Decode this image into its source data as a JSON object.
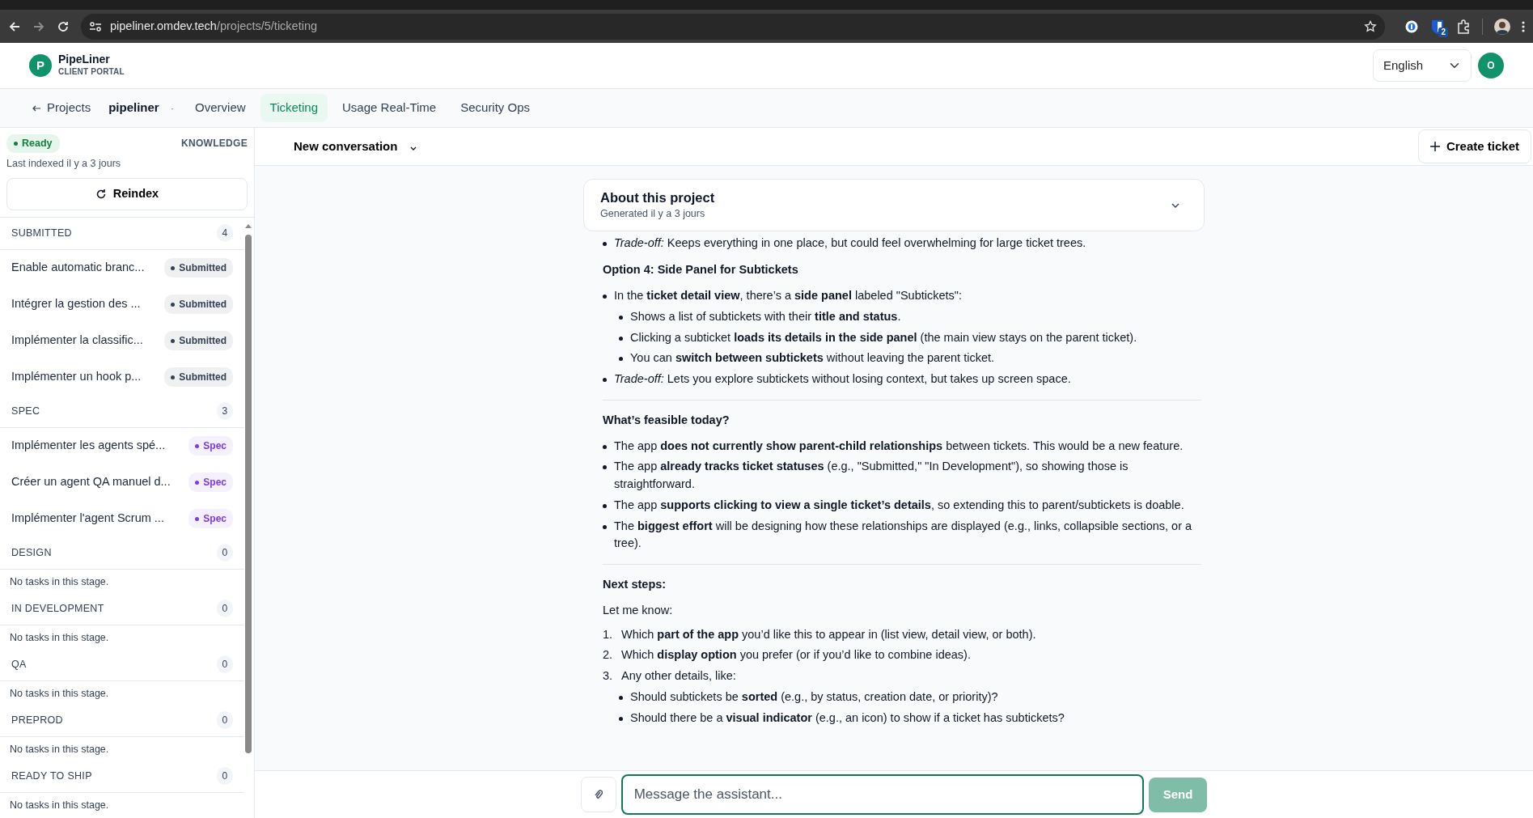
{
  "browser": {
    "url_host": "pipeliner.omdev.tech",
    "url_path": "/projects/5/ticketing",
    "extension_badge": "2"
  },
  "header": {
    "logo_letter": "P",
    "app_name": "PipeLiner",
    "app_subtitle": "CLIENT PORTAL",
    "language": "English",
    "avatar_letter": "O"
  },
  "nav": {
    "back": "Projects",
    "project": "pipeliner",
    "separator": "·",
    "tabs": [
      {
        "label": "Overview",
        "selected": false
      },
      {
        "label": "Ticketing",
        "selected": true
      },
      {
        "label": "Usage Real-Time",
        "selected": false
      },
      {
        "label": "Security Ops",
        "selected": false
      }
    ]
  },
  "sidebar": {
    "status": "Ready",
    "knowledge": "KNOWLEDGE",
    "last_indexed": "Last indexed il y a 3 jours",
    "reindex": "Reindex",
    "stages": [
      {
        "name": "SUBMITTED",
        "count": "4",
        "tickets": [
          {
            "title": "Enable automatic branc...",
            "status": "Submitted",
            "color": "#334155"
          },
          {
            "title": "Intégrer la gestion des ...",
            "status": "Submitted",
            "color": "#334155"
          },
          {
            "title": "Implémenter la classific...",
            "status": "Submitted",
            "color": "#334155"
          },
          {
            "title": "Implémenter un hook p...",
            "status": "Submitted",
            "color": "#334155"
          }
        ]
      },
      {
        "name": "SPEC",
        "count": "3",
        "tickets": [
          {
            "title": "Implémenter les agents spé...",
            "status": "Spec",
            "color": "#7c3aed"
          },
          {
            "title": "Créer un agent QA manuel d...",
            "status": "Spec",
            "color": "#7c3aed"
          },
          {
            "title": "Implémenter l'agent Scrum ...",
            "status": "Spec",
            "color": "#7c3aed"
          }
        ]
      },
      {
        "name": "DESIGN",
        "count": "0",
        "empty": "No tasks in this stage."
      },
      {
        "name": "IN DEVELOPMENT",
        "count": "0",
        "empty": "No tasks in this stage."
      },
      {
        "name": "QA",
        "count": "0",
        "empty": "No tasks in this stage."
      },
      {
        "name": "PREPROD",
        "count": "0",
        "empty": "No tasks in this stage."
      },
      {
        "name": "READY TO SHIP",
        "count": "0",
        "empty": "No tasks in this stage."
      }
    ]
  },
  "chat": {
    "conversation": "New conversation",
    "create_ticket": "Create ticket",
    "about": {
      "title": "About this project",
      "subtitle": "Generated il y a 3 jours",
      "expanded": false
    },
    "blocks": [
      {
        "kind": "bullets",
        "items": [
          {
            "text": "*Trade-off:* Keeps everything in one place, but could feel overwhelming for large ticket trees."
          }
        ]
      },
      {
        "kind": "heading",
        "text": "Option 4: Side Panel for Subtickets"
      },
      {
        "kind": "bullets",
        "items": [
          {
            "text": "In the **ticket detail view**, there’s a **side panel** labeled \"Subtickets\":",
            "children": [
              {
                "text": "Shows a list of subtickets with their **title and status**."
              },
              {
                "text": "Clicking a subticket **loads its details in the side panel** (the main view stays on the parent ticket)."
              },
              {
                "text": "You can **switch between subtickets** without leaving the parent ticket."
              }
            ]
          },
          {
            "text": "*Trade-off:* Lets you explore subtickets without losing context, but takes up screen space."
          }
        ]
      },
      {
        "kind": "divider"
      },
      {
        "kind": "heading",
        "text": "What’s feasible today?"
      },
      {
        "kind": "bullets",
        "items": [
          {
            "text": "The app **does not currently show parent-child relationships** between tickets. This would be a new feature."
          },
          {
            "text": "The app **already tracks ticket statuses** (e.g., \"Submitted,\" \"In Development\"), so showing those is straightforward."
          },
          {
            "text": "The app **supports clicking to view a single ticket’s details**, so extending this to parent/subtickets is doable."
          },
          {
            "text": "The **biggest effort** will be designing how these relationships are displayed (e.g., links, collapsible sections, or a tree)."
          }
        ]
      },
      {
        "kind": "divider"
      },
      {
        "kind": "heading",
        "text": "Next steps:"
      },
      {
        "kind": "paragraph",
        "text": "Let me know:"
      },
      {
        "kind": "numbered",
        "items": [
          {
            "number": "1.",
            "text": "Which **part of the app** you’d like this to appear in (list view, detail view, or both)."
          },
          {
            "number": "2.",
            "text": "Which **display option** you prefer (or if you’d like to combine ideas)."
          },
          {
            "number": "3.",
            "text": "Any other details, like:",
            "children": [
              {
                "text": "Should subtickets be **sorted** (e.g., by status, creation date, or priority)?"
              },
              {
                "text": "Should there be a **visual indicator** (e.g., an icon) to show if a ticket has subtickets?"
              }
            ]
          }
        ]
      }
    ],
    "input": {
      "placeholder": "Message the assistant...",
      "send": "Send",
      "send_disabled": true
    }
  }
}
